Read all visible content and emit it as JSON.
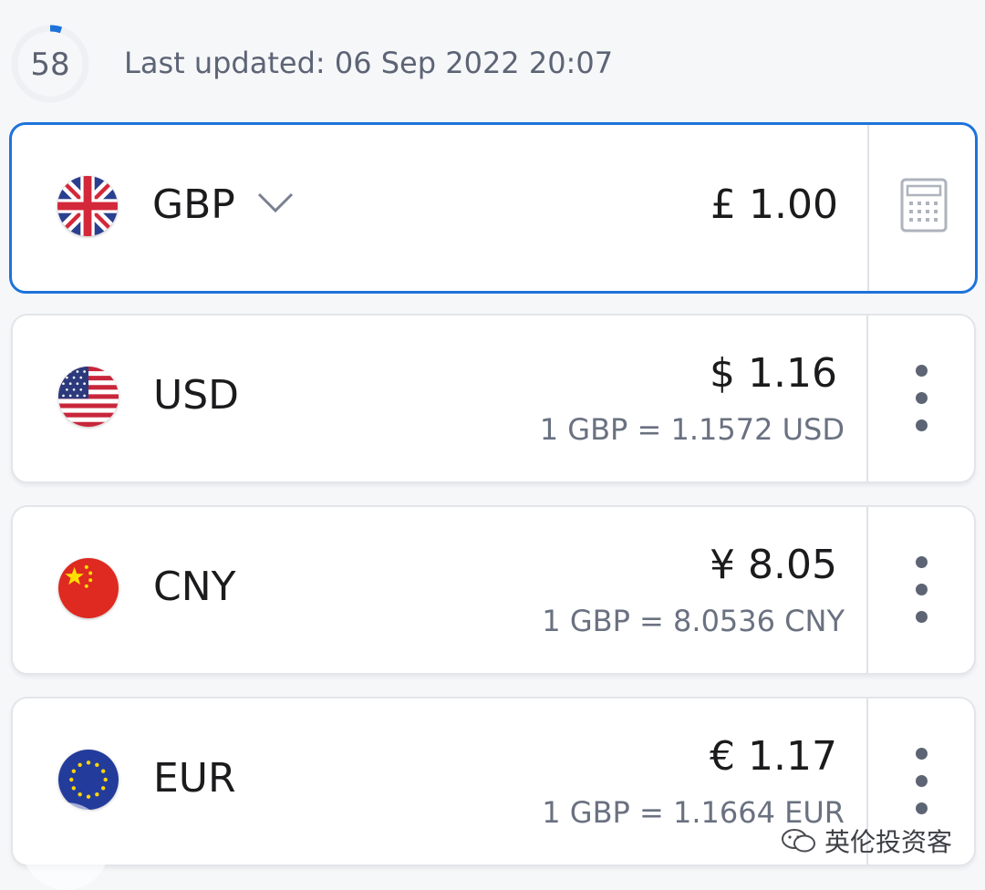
{
  "header": {
    "timer_value": "58",
    "timer_progress": 0.05,
    "last_updated": "Last updated: 06 Sep 2022 20:07"
  },
  "colors": {
    "accent": "#1e73d9",
    "text_secondary": "#5c6475"
  },
  "base_currency": {
    "flag_icon": "uk-flag-icon",
    "code": "GBP",
    "amount": "£ 1.00"
  },
  "currencies": [
    {
      "flag_icon": "us-flag-icon",
      "code": "USD",
      "amount": "$ 1.16",
      "rate": "1 GBP = 1.1572 USD"
    },
    {
      "flag_icon": "cn-flag-icon",
      "code": "CNY",
      "amount": "¥ 8.05",
      "rate": "1 GBP = 8.0536 CNY"
    },
    {
      "flag_icon": "eu-flag-icon",
      "code": "EUR",
      "amount": "€ 1.17",
      "rate": "1 GBP = 1.1664 EUR"
    }
  ],
  "watermark": {
    "text": "英伦投资客"
  }
}
